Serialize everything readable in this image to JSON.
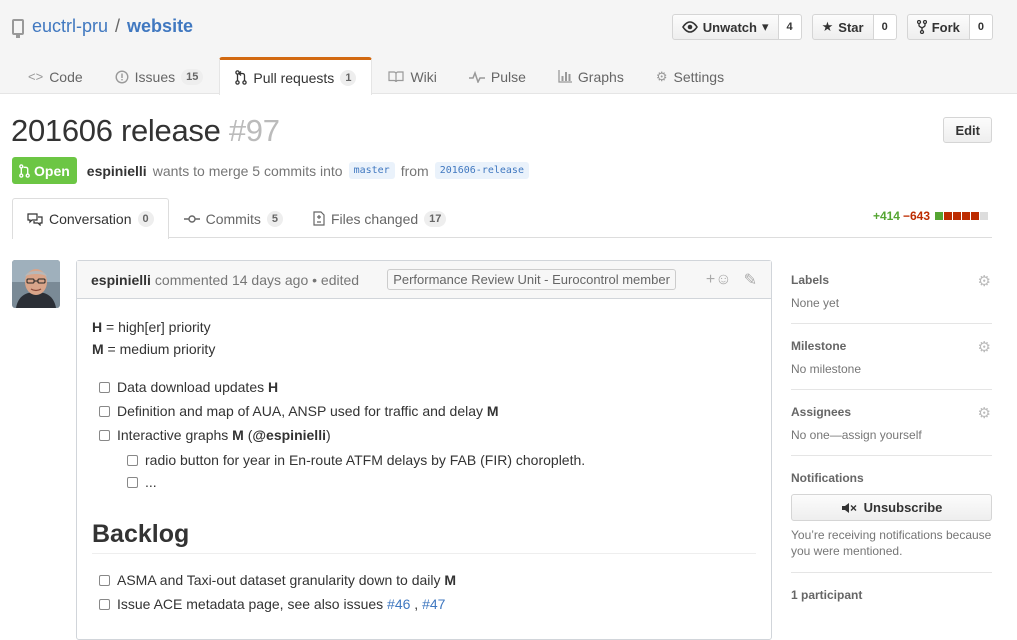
{
  "repo": {
    "owner": "euctrl-pru",
    "separator": "/",
    "name": "website"
  },
  "actions": {
    "watch": {
      "label": "Unwatch",
      "count": "4"
    },
    "star": {
      "label": "Star",
      "count": "0"
    },
    "fork": {
      "label": "Fork",
      "count": "0"
    }
  },
  "nav": {
    "code": "Code",
    "issues": "Issues",
    "issues_count": "15",
    "pulls": "Pull requests",
    "pulls_count": "1",
    "wiki": "Wiki",
    "pulse": "Pulse",
    "graphs": "Graphs",
    "settings": "Settings"
  },
  "pr": {
    "title": "201606 release",
    "number": "#97",
    "edit_label": "Edit",
    "state": "Open",
    "author": "espinielli",
    "merge_text": "wants to merge 5 commits into",
    "base_branch": "master",
    "from_text": "from",
    "head_branch": "201606-release"
  },
  "tabs": {
    "conversation": "Conversation",
    "conversation_count": "0",
    "commits": "Commits",
    "commits_count": "5",
    "files": "Files changed",
    "files_count": "17"
  },
  "diffstat": {
    "additions": "+414",
    "deletions": "−643",
    "blocks": [
      "#55a532",
      "#bd2c00",
      "#bd2c00",
      "#bd2c00",
      "#bd2c00",
      "#ddd"
    ]
  },
  "comment": {
    "author": "espinielli",
    "meta": "commented 14 days ago • edited",
    "role": "Performance Review Unit - Eurocontrol member",
    "legend": [
      {
        "key": "H",
        "text": " = high[er] priority"
      },
      {
        "key": "M",
        "text": " = medium priority"
      }
    ],
    "tasks": {
      "t1_text": "Data download updates ",
      "t1_flag": "H",
      "t2_text": "Definition and map of AUA, ANSP used for traffic and delay ",
      "t2_flag": "M",
      "t3_text": "Interactive graphs ",
      "t3_flag": "M",
      "t3_open": " (",
      "t3_mention": "@espinielli",
      "t3_close": ")",
      "sub1": "radio button for year in En-route ATFM delays by FAB (FIR) choropleth.",
      "sub2": "..."
    },
    "backlog_heading": "Backlog",
    "backlog": {
      "b1_text": "ASMA and Taxi-out dataset granularity down to daily ",
      "b1_flag": "M",
      "b2_text": "Issue ACE metadata page, see also issues ",
      "b2_link1": "#46",
      "b2_sep": " , ",
      "b2_link2": "#47"
    }
  },
  "sidebar": {
    "labels_heading": "Labels",
    "labels_value": "None yet",
    "milestone_heading": "Milestone",
    "milestone_value": "No milestone",
    "assignees_heading": "Assignees",
    "assignees_value": "No one—assign yourself",
    "notifications_heading": "Notifications",
    "unsubscribe_label": "Unsubscribe",
    "notifications_reason": "You’re receiving notifications because you were mentioned.",
    "participants_heading": "1 participant"
  },
  "colors": {
    "accent": "#4078c0",
    "open": "#6cc644",
    "nav_selected": "#d26911"
  }
}
